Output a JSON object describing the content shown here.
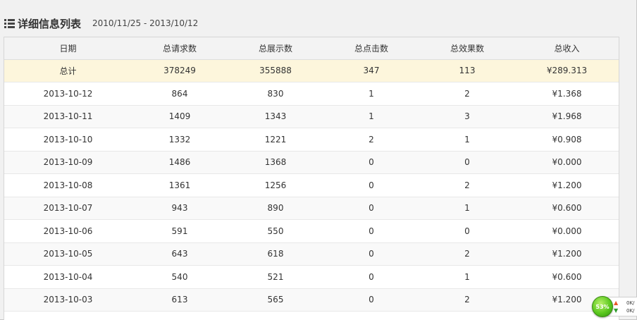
{
  "header": {
    "title": "详细信息列表",
    "date_range": "2010/11/25 - 2013/10/12"
  },
  "table": {
    "columns": [
      "日期",
      "总请求数",
      "总展示数",
      "总点击数",
      "总效果数",
      "总收入"
    ],
    "total": [
      "总计",
      "378249",
      "355888",
      "347",
      "113",
      "¥289.313"
    ],
    "rows": [
      [
        "2013-10-12",
        "864",
        "830",
        "1",
        "2",
        "¥1.368"
      ],
      [
        "2013-10-11",
        "1409",
        "1343",
        "1",
        "3",
        "¥1.968"
      ],
      [
        "2013-10-10",
        "1332",
        "1221",
        "2",
        "1",
        "¥0.908"
      ],
      [
        "2013-10-09",
        "1486",
        "1368",
        "0",
        "0",
        "¥0.000"
      ],
      [
        "2013-10-08",
        "1361",
        "1256",
        "0",
        "2",
        "¥1.200"
      ],
      [
        "2013-10-07",
        "943",
        "890",
        "0",
        "1",
        "¥0.600"
      ],
      [
        "2013-10-06",
        "591",
        "550",
        "0",
        "0",
        "¥0.000"
      ],
      [
        "2013-10-05",
        "643",
        "618",
        "0",
        "2",
        "¥1.200"
      ],
      [
        "2013-10-04",
        "540",
        "521",
        "0",
        "1",
        "¥0.600"
      ],
      [
        "2013-10-03",
        "613",
        "565",
        "0",
        "2",
        "¥1.200"
      ],
      [
        "",
        "",
        "",
        "",
        "",
        ""
      ]
    ]
  },
  "widget": {
    "percent": "53%",
    "upload": "0K/",
    "download": "0K/",
    "ball_color": "#5bc81f"
  },
  "colors": {
    "total_row": "#fdf6dc",
    "header_row": "#f3f3f3"
  },
  "icons": [
    "list-icon",
    "upload-arrow-icon",
    "download-arrow-icon"
  ]
}
